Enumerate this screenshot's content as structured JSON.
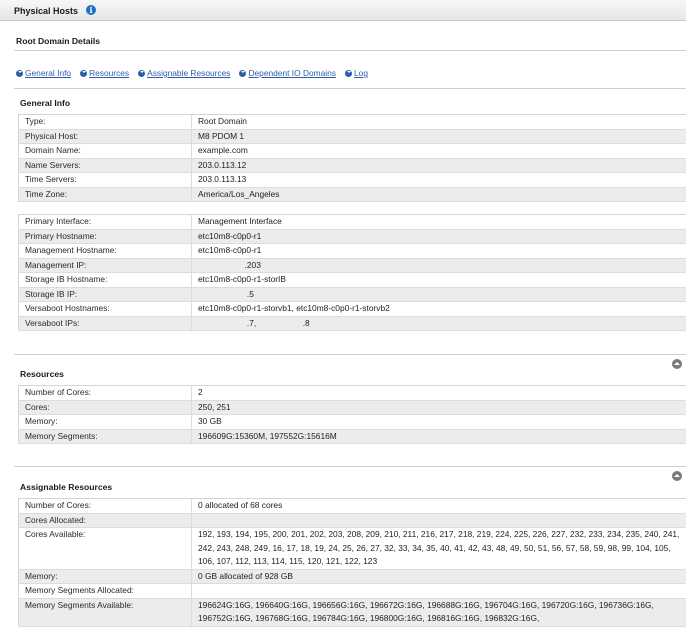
{
  "topbar": {
    "title": "Physical Hosts",
    "info_icon": "i"
  },
  "page_header": "Root Domain Details",
  "tabs": [
    {
      "label": "General Info"
    },
    {
      "label": "Resources"
    },
    {
      "label": "Assignable Resources"
    },
    {
      "label": "Dependent IO Domains"
    },
    {
      "label": "Log"
    }
  ],
  "general_info": {
    "title": "General Info",
    "rows1": [
      {
        "k": "Type:",
        "v": "Root Domain"
      },
      {
        "k": "Physical Host:",
        "v": "M8 PDOM 1"
      },
      {
        "k": "Domain Name:",
        "v": "example.com"
      },
      {
        "k": "Name Servers:",
        "v": "203.0.113.12"
      },
      {
        "k": "Time Servers:",
        "v": "203.0.113.13"
      },
      {
        "k": "Time Zone:",
        "v": "America/Los_Angeles"
      }
    ],
    "rows2": [
      {
        "k": "Primary Interface:",
        "v": "Management Interface"
      },
      {
        "k": "Primary Hostname:",
        "v": "etc10m8-c0p0-r1"
      },
      {
        "k": "Management Hostname:",
        "v": "etc10m8-c0p0-r1"
      },
      {
        "k": "Management IP:",
        "v": "                    .203"
      },
      {
        "k": "Storage IB Hostname:",
        "v": "etc10m8-c0p0-r1-storIB"
      },
      {
        "k": "Storage IB IP:",
        "v": "                     .5"
      },
      {
        "k": "Versaboot Hostnames:",
        "v": "etc10m8-c0p0-r1-storvb1, etc10m8-c0p0-r1-storvb2"
      },
      {
        "k": "Versaboot IPs:",
        "v": "                     .7,                    .8"
      }
    ]
  },
  "resources": {
    "title": "Resources",
    "rows": [
      {
        "k": "Number of Cores:",
        "v": "2"
      },
      {
        "k": "Cores:",
        "v": "250, 251"
      },
      {
        "k": "Memory:",
        "v": "30 GB"
      },
      {
        "k": "Memory Segments:",
        "v": "196609G:15360M, 197552G:15616M"
      }
    ]
  },
  "assignable": {
    "title": "Assignable Resources",
    "rows": [
      {
        "k": "Number of Cores:",
        "v": "0 allocated of 68 cores"
      },
      {
        "k": "Cores Allocated:",
        "v": ""
      },
      {
        "k": "Cores Available:",
        "v": "192, 193, 194, 195, 200, 201, 202, 203, 208, 209, 210, 211, 216, 217, 218, 219, 224, 225, 226, 227, 232, 233, 234, 235, 240, 241, 242, 243, 248, 249, 16, 17, 18, 19, 24, 25, 26, 27, 32, 33, 34, 35, 40, 41, 42, 43, 48, 49, 50, 51, 56, 57, 58, 59, 98, 99, 104, 105, 106, 107, 112, 113, 114, 115, 120, 121, 122, 123"
      },
      {
        "k": "Memory:",
        "v": "0 GB allocated of 928 GB"
      },
      {
        "k": "Memory Segments Allocated:",
        "v": ""
      },
      {
        "k": "Memory Segments Available:",
        "v": "196624G:16G, 196640G:16G, 196656G:16G, 196672G:16G, 196688G:16G, 196704G:16G, 196720G:16G, 196736G:16G, 196752G:16G, 196768G:16G, 196784G:16G, 196800G:16G, 196816G:16G, 196832G:16G,"
      }
    ]
  },
  "colors": {
    "link": "#2d5da8",
    "info_icon": "#1f6fc5",
    "row_alt": "#ececec"
  }
}
